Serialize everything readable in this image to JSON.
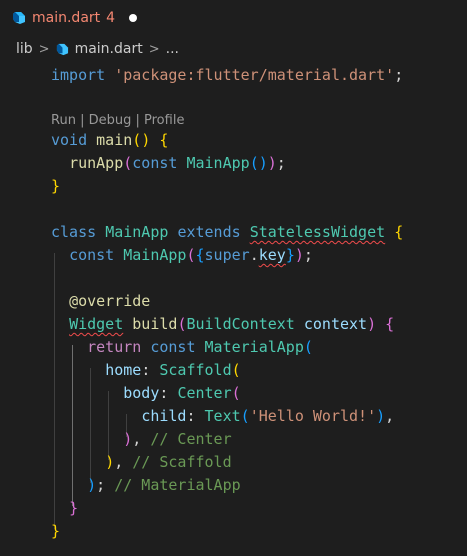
{
  "tab": {
    "filename": "main.dart",
    "problem_count": "4",
    "icon": "dart-icon"
  },
  "breadcrumb": {
    "folder": "lib",
    "file": "main.dart",
    "more": "..."
  },
  "codelens": {
    "run": "Run",
    "sep1": " | ",
    "debug": "Debug",
    "sep2": " | ",
    "profile": "Profile"
  },
  "code": {
    "l1": {
      "kw": "import",
      "sp": " ",
      "str": "'package:flutter/material.dart'",
      "semi": ";"
    },
    "l3": {
      "kw": "void",
      "sp": " ",
      "fn": "main",
      "open": "(",
      "close": ")",
      "sp2": " ",
      "brace": "{"
    },
    "l4": {
      "indent": "  ",
      "fn": "runApp",
      "o1": "(",
      "kw": "const",
      "sp": " ",
      "type": "MainApp",
      "o2": "(",
      "c2": ")",
      "c1": ")",
      "semi": ";"
    },
    "l5": {
      "brace": "}"
    },
    "l7": {
      "kw1": "class",
      "sp1": " ",
      "type1": "MainApp",
      "sp2": " ",
      "kw2": "extends",
      "sp3": " ",
      "type2": "StatelessWidget",
      "sp4": " ",
      "brace": "{"
    },
    "l8": {
      "indent": "  ",
      "kw": "const",
      "sp": " ",
      "type": "MainApp",
      "o1": "(",
      "ob": "{",
      "kw2": "super",
      "dot": ".",
      "var": "key",
      "cb": "}",
      "c1": ")",
      "semi": ";"
    },
    "l10": {
      "indent": "  ",
      "ann": "@override"
    },
    "l11": {
      "indent": "  ",
      "type": "Widget",
      "sp": " ",
      "fn": "build",
      "o": "(",
      "type2": "BuildContext",
      "sp2": " ",
      "var": "context",
      "c": ")",
      "sp3": " ",
      "brace": "{"
    },
    "l12": {
      "indent": "    ",
      "ctrl": "return",
      "sp": " ",
      "kw": "const",
      "sp2": " ",
      "type": "MaterialApp",
      "o": "("
    },
    "l13": {
      "indent": "      ",
      "var": "home",
      "colon": ": ",
      "type": "Scaffold",
      "o": "("
    },
    "l14": {
      "indent": "        ",
      "var": "body",
      "colon": ": ",
      "type": "Center",
      "o": "("
    },
    "l15": {
      "indent": "          ",
      "var": "child",
      "colon": ": ",
      "type": "Text",
      "o": "(",
      "str": "'Hello World!'",
      "c": ")",
      "comma": ","
    },
    "l16": {
      "indent": "        ",
      "c": ")",
      "comma": ", ",
      "cmt": "// Center"
    },
    "l17": {
      "indent": "      ",
      "c": ")",
      "comma": ", ",
      "cmt": "// Scaffold"
    },
    "l18": {
      "indent": "    ",
      "c": ")",
      "semi": "; ",
      "cmt": "// MaterialApp"
    },
    "l19": {
      "indent": "  ",
      "brace": "}"
    },
    "l20": {
      "brace": "}"
    }
  },
  "colors": {
    "background": "#1e1e1e",
    "tab_error": "#f48771",
    "keyword": "#569cd6",
    "control": "#c586c0",
    "string": "#ce9178",
    "function": "#dcdcaa",
    "type": "#4ec9b0",
    "variable": "#9cdcfe",
    "comment": "#6a9955",
    "bracket1": "#ffd700",
    "bracket2": "#da70d6",
    "bracket3": "#179fff",
    "squiggle": "#f14c4c"
  }
}
